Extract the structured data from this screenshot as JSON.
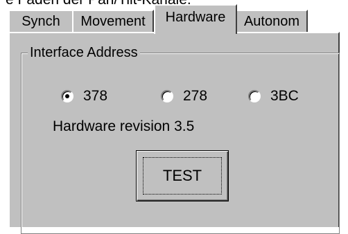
{
  "top_cut_text": "e Faden der Pan/Tilt-Kanäle.",
  "tabs": [
    {
      "label": "Synch",
      "active": false
    },
    {
      "label": "Movement",
      "active": false
    },
    {
      "label": "Hardware",
      "active": true
    },
    {
      "label": "Autonom",
      "active": false
    }
  ],
  "group": {
    "legend": "Interface Address",
    "radios": [
      {
        "label": "378",
        "checked": true
      },
      {
        "label": "278",
        "checked": false
      },
      {
        "label": "3BC",
        "checked": false
      }
    ]
  },
  "revision_text": "Hardware revision 3.5",
  "test_button": "TEST",
  "colors": {
    "face": "#c0c0c0",
    "highlight": "#ffffff",
    "shadow": "#808080",
    "dark": "#404040"
  }
}
